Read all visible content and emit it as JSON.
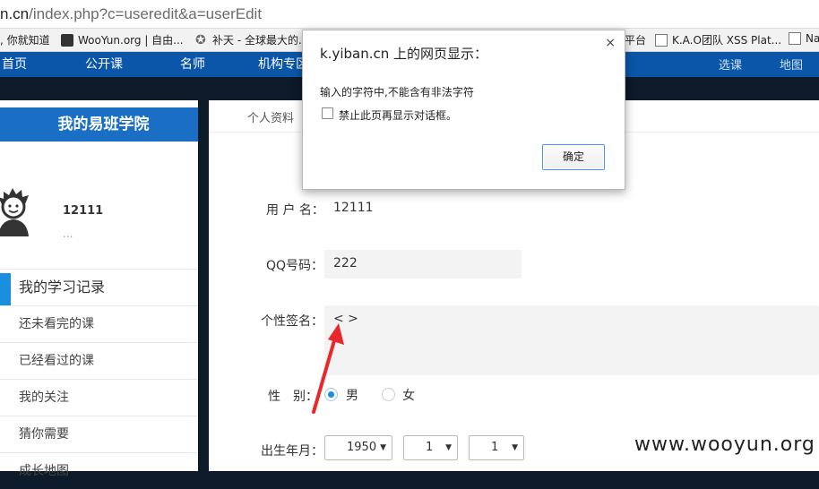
{
  "browser": {
    "address_host": "n.cn",
    "address_path": "/index.php?c=useredit&a=userEdit",
    "bookmarks": [
      {
        "label": ", 你就知道",
        "icon": "none-icon"
      },
      {
        "label": "WooYun.org | 自由...",
        "icon": "wooyun-icon"
      },
      {
        "label": "补天 - 全球最大的...",
        "icon": "star-icon"
      },
      {
        "label": "平台",
        "icon": "none-icon"
      },
      {
        "label": "K.A.O团队 XSS Plat...",
        "icon": "page-icon"
      },
      {
        "label": "Na",
        "icon": "page-icon"
      }
    ]
  },
  "site_nav": {
    "items": [
      "首页",
      "公开课",
      "名师",
      "机构专区"
    ],
    "right_items": [
      "选课",
      "地图"
    ]
  },
  "left_panel": {
    "title": "我的易班学院",
    "username": "12111",
    "user_extra": "...",
    "menu": [
      {
        "label": "我的学习记录",
        "active": true
      },
      {
        "label": "还未看完的课",
        "active": false
      },
      {
        "label": "已经看过的课",
        "active": false
      },
      {
        "label": "我的关注",
        "active": false
      },
      {
        "label": "猜你需要",
        "active": false
      },
      {
        "label": "成长地图",
        "active": false
      }
    ]
  },
  "main": {
    "tab": "个人资料",
    "form": {
      "username_label": "用 户 名：",
      "username_value": "12111",
      "qq_label": "QQ号码：",
      "qq_value": "222",
      "signature_label": "个性签名：",
      "signature_value": "< >",
      "gender_label": "性　别：",
      "gender_options": [
        "男",
        "女"
      ],
      "gender_selected": "男",
      "birth_label": "出生年月：",
      "birth_year": "1950",
      "birth_month": "1",
      "birth_day": "1"
    }
  },
  "dialog": {
    "title": "k.yiban.cn 上的网页显示：",
    "message": "输入的字符中,不能含有非法字符",
    "checkbox_label": "禁止此页再显示对话框。",
    "ok_label": "确定",
    "close_symbol": "×"
  },
  "watermark": "www.wooyun.org",
  "colors": {
    "nav_blue": "#0b56a8",
    "panel_blue": "#1a6fc4",
    "accent": "#1a8fe0",
    "arrow_red": "#e8282b",
    "dark_bg": "#0d1a2a"
  }
}
